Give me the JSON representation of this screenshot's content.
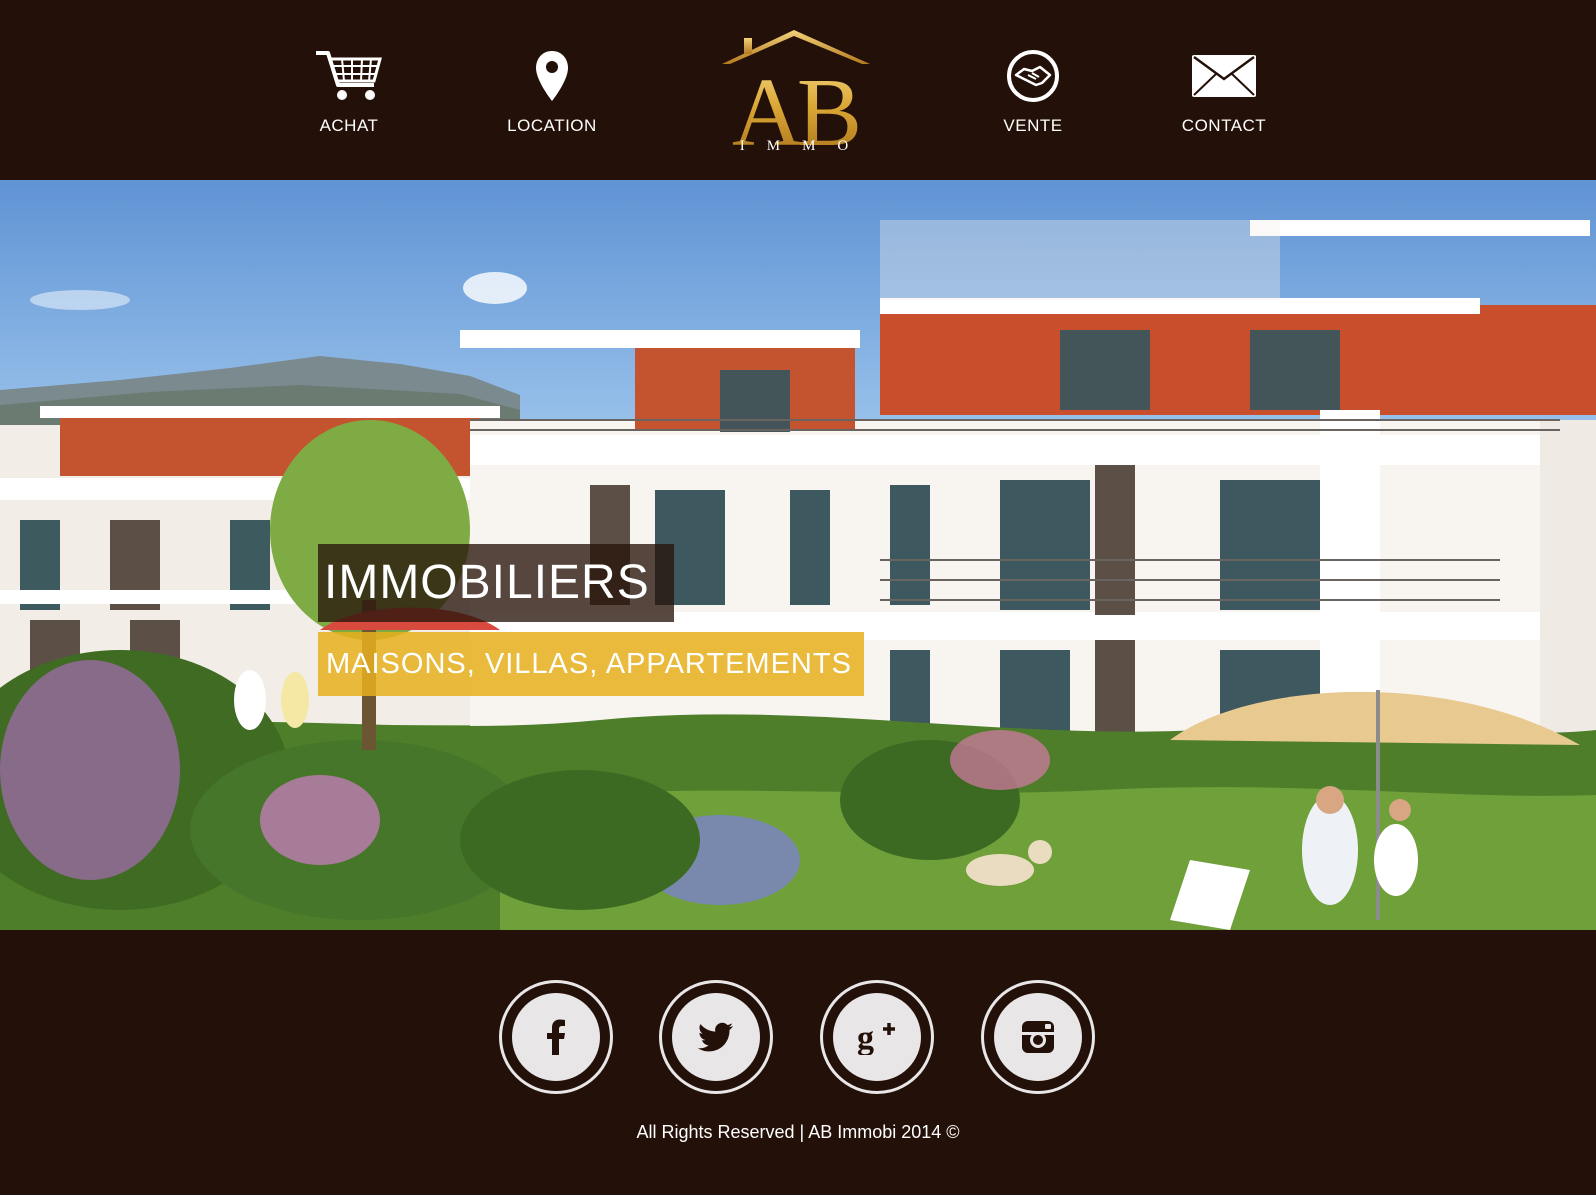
{
  "nav": {
    "items": [
      {
        "label": "ACHAT",
        "icon": "shopping-cart-icon"
      },
      {
        "label": "LOCATION",
        "icon": "map-pin-icon"
      },
      {
        "label": "VENTE",
        "icon": "handshake-icon"
      },
      {
        "label": "CONTACT",
        "icon": "envelope-icon"
      }
    ]
  },
  "logo": {
    "main": "AB",
    "sub": "IMMO"
  },
  "hero": {
    "title": "IMMOBILIERS",
    "subtitle": "MAISONS, VILLAS, APPARTEMENTS"
  },
  "social": [
    {
      "icon": "facebook-icon"
    },
    {
      "icon": "twitter-icon"
    },
    {
      "icon": "google-plus-icon"
    },
    {
      "icon": "instagram-icon"
    }
  ],
  "footer": {
    "copyright": "All Rights Reserved | AB Immobi 2014 ©"
  },
  "colors": {
    "background": "#231008",
    "accent_gold": "#d9a533",
    "title_box": "#28140c",
    "subtitle_box": "#e6b01e"
  }
}
